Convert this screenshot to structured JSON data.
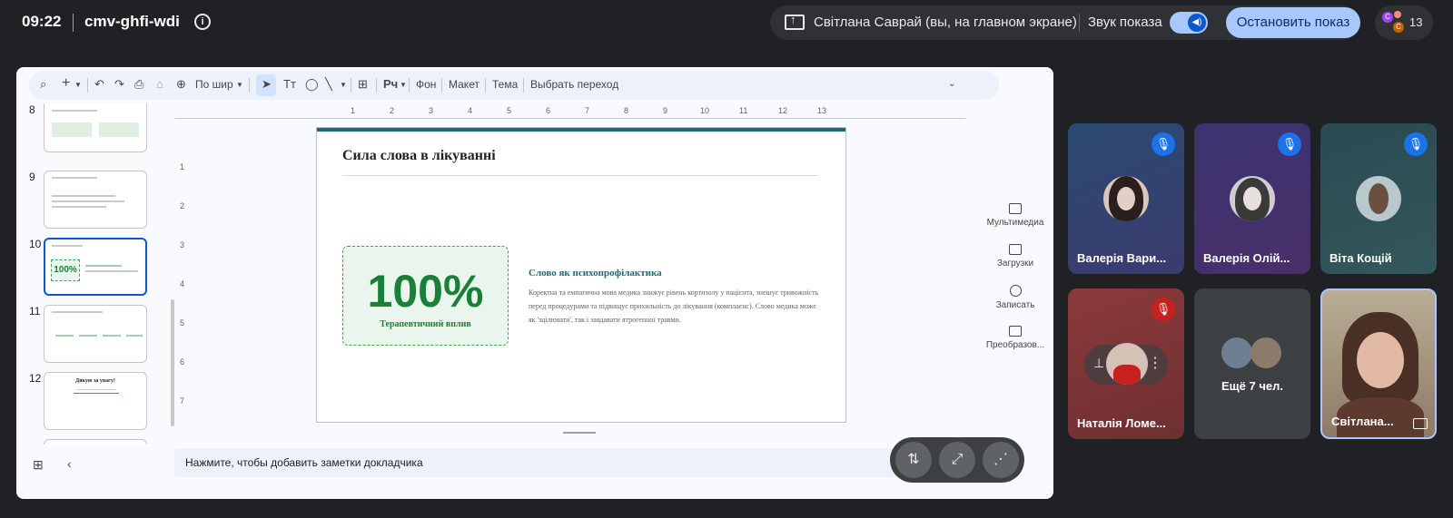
{
  "meeting": {
    "time": "09:22",
    "code": "cmv-ghfi-wdi"
  },
  "share_bar": {
    "presenter": "Світлана Саврай (вы, на главном экране)",
    "sound_label": "Звук показа",
    "stop_label": "Остановить показ"
  },
  "people": {
    "count": "13",
    "avatar_letters": [
      "C",
      "C"
    ]
  },
  "toolbar": {
    "zoom": "По шир",
    "background": "Фон",
    "layout": "Макет",
    "theme": "Тема",
    "transition": "Выбрать переход"
  },
  "thumbnails": [
    {
      "num": "8"
    },
    {
      "num": "9"
    },
    {
      "num": "10",
      "big": "100%"
    },
    {
      "num": "11"
    },
    {
      "num": "12",
      "title": "Дякую за увагу!"
    }
  ],
  "ruler": [
    "1",
    "2",
    "3",
    "4",
    "5",
    "6",
    "7",
    "8",
    "9",
    "10",
    "11",
    "12",
    "13"
  ],
  "ruler_left": [
    "1",
    "2",
    "3",
    "4",
    "5",
    "6",
    "7"
  ],
  "slide": {
    "title": "Сила слова в лікуванні",
    "stat": "100%",
    "stat_caption": "Терапевтичний вплив",
    "subheading": "Слово як психопрофілактика",
    "body": "Коректна та емпатична мова медика знижує рівень кортизолу у пацієнта, знешує тривожність перед процедурами та підвищує прихильність до лікування (комплаєнс). Слово медика може як 'зцілювати', так і завдавати ятрогенної травми."
  },
  "side_panel": [
    "Мультимедиа",
    "Загрузки",
    "Записать",
    "Преобразов..."
  ],
  "notes_placeholder": "Нажмите, чтобы добавить заметки докладчика",
  "participants": [
    {
      "name": "Валерія Вари...",
      "muted": true
    },
    {
      "name": "Валерія Олій...",
      "muted": true
    },
    {
      "name": "Віта Кощій",
      "muted": true
    },
    {
      "name": "Наталія Ломе...",
      "muted": true
    },
    {
      "more": "Ещё 7 чел."
    },
    {
      "name": "Світлана..."
    }
  ]
}
